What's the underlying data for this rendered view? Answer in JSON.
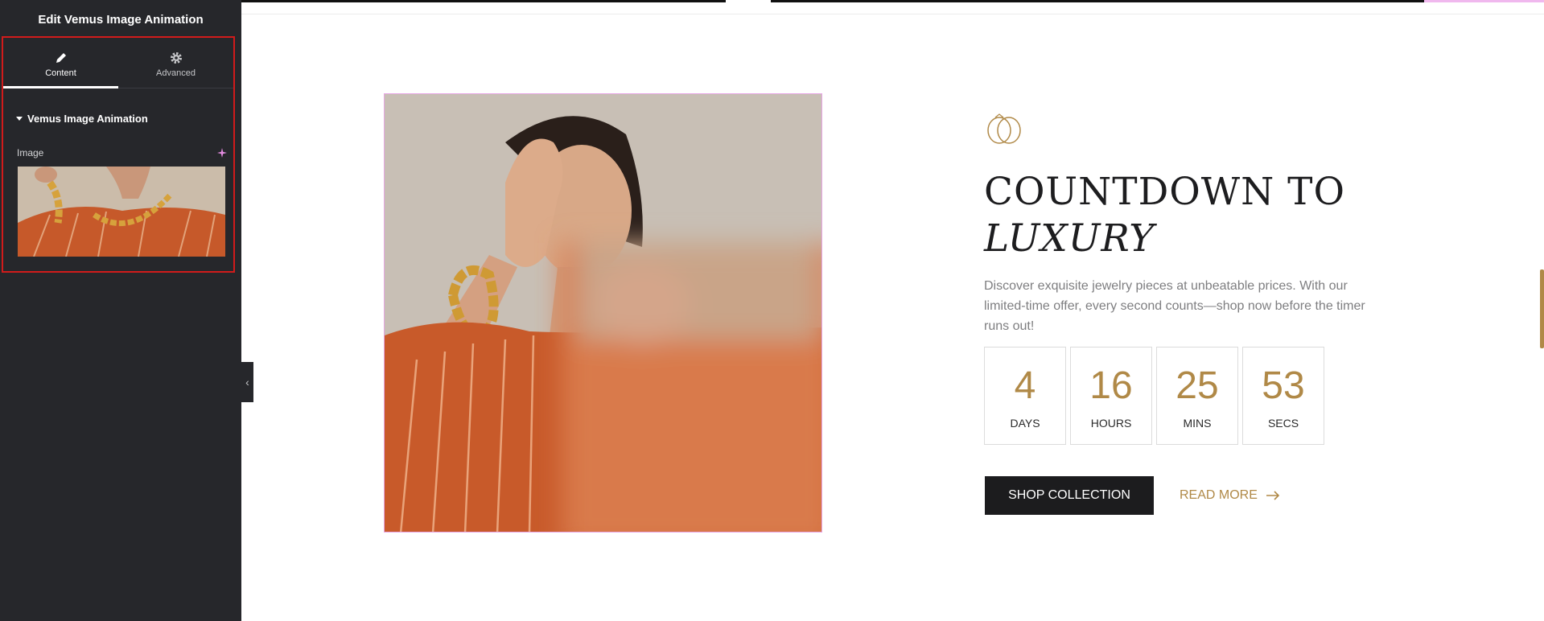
{
  "panel": {
    "title": "Edit Vemus Image Animation",
    "tabs": [
      {
        "label": "Content",
        "icon": "pencil-icon",
        "active": true
      },
      {
        "label": "Advanced",
        "icon": "gear-icon",
        "active": false
      }
    ],
    "section_title": "Vemus Image Animation",
    "image_label": "Image",
    "collapse_icon": "chevron-left-icon"
  },
  "hero": {
    "heading_line1": "COUNTDOWN TO",
    "heading_line2": "LUXURY",
    "description": "Discover exquisite jewelry pieces at unbeatable prices. With our limited-time offer, every second counts—shop now before the timer runs out!",
    "countdown": [
      {
        "value": "4",
        "label": "DAYS"
      },
      {
        "value": "16",
        "label": "HOURS"
      },
      {
        "value": "25",
        "label": "MINS"
      },
      {
        "value": "53",
        "label": "SECS"
      }
    ],
    "shop_button": "SHOP COLLECTION",
    "read_more": "READ MORE"
  },
  "colors": {
    "panel_bg": "#26272b",
    "accent_gold": "#b08947",
    "highlight_red": "#d11b1b",
    "selection_pink": "#e7a6e3",
    "dark_button": "#1c1c1e"
  }
}
